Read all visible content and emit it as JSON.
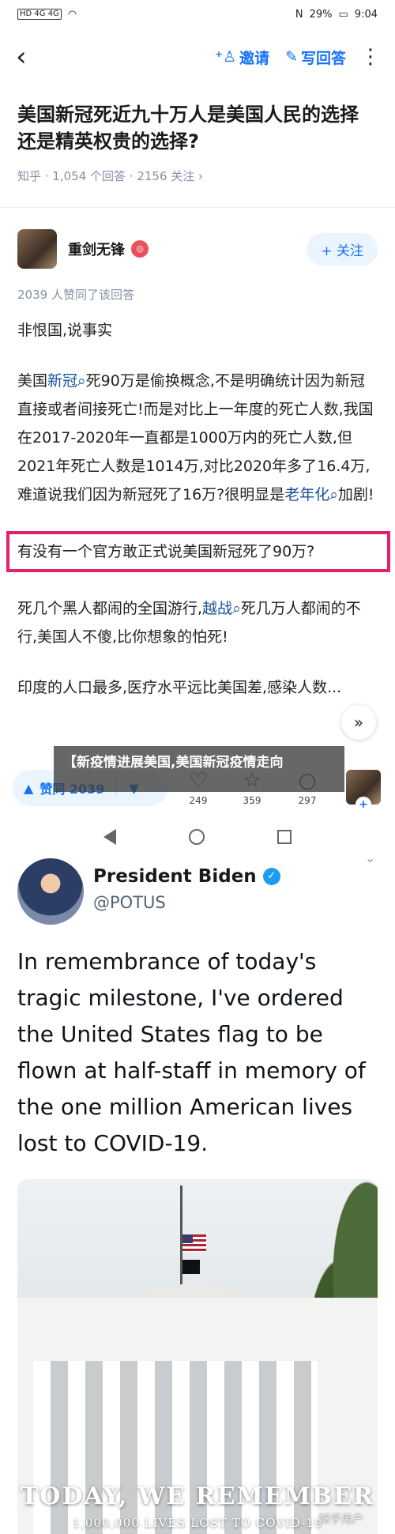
{
  "status_bar": {
    "network": "HD 4G 4G",
    "battery": "29%",
    "time": "9:04"
  },
  "top_bar": {
    "invite_label": "邀请",
    "write_answer_label": "写回答"
  },
  "question": {
    "title": "美国新冠死近九十万人是美国人民的选择还是精英权贵的选择?",
    "meta": "知乎 · 1,054 个回答 · 2156 关注 ›"
  },
  "author": {
    "name": "重剑无锋",
    "follow_label": "+ 关注"
  },
  "answer": {
    "likes_line": "2039 人赞同了该回答",
    "p1": "非恨国,说事实",
    "p2_a": "美国",
    "p2_link1": "新冠",
    "p2_b": "死90万是偷换概念,不是明确统计因为新冠直接或者间接死亡!而是对比上一年度的死亡人数,我国在2017-2020年一直都是1000万内的死亡人数,但2021年死亡人数是1014万,对比2020年多了16.4万,难道说我们因为新冠死了16万?很明显是",
    "p2_link2": "老年化",
    "p2_c": "加剧!",
    "p3": "有没有一个官方敢正式说美国新冠死了90万?",
    "p4_a": "死几个黑人都闹的全国游行,",
    "p4_link": "越战",
    "p4_b": "死几万人都闹的不行,美国人不傻,比你想象的怕死!",
    "p5": "印度的人口最多,医疗水平远比美国差,感染人数..."
  },
  "bottom_bar": {
    "vote_label": "赞同 2039",
    "comment_count": "249",
    "favorite_count": "359",
    "reply_count": "297"
  },
  "banner": {
    "text": "【新疫情进展美国,美国新冠疫情走向"
  },
  "tweet": {
    "name": "President Biden",
    "handle": "@POTUS",
    "text": "In remembrance of today's tragic milestone, I've ordered the United States flag to be flown at half-staff in memory of the one million American lives lost to COVID-19.",
    "image_title": "TODAY, WE REMEMBER",
    "image_subtitle": "1,000,000 LIVES LOST TO COVID-19"
  },
  "watermark": "知乎用户",
  "colors": {
    "accent": "#1772f6",
    "highlight_border": "#e3206b",
    "link": "#175199"
  }
}
